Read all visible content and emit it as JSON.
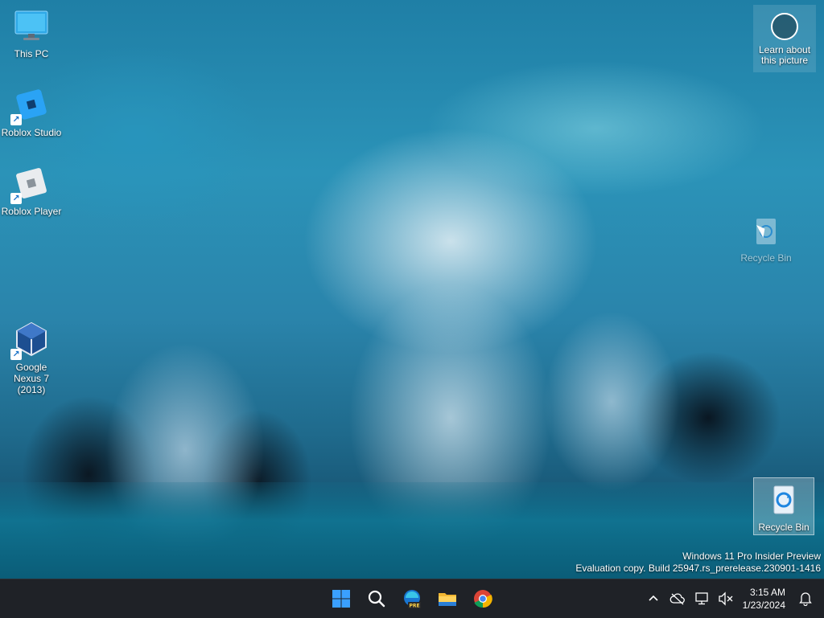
{
  "desktop": {
    "icons_left": [
      {
        "label": "This PC",
        "icon": "monitor-icon"
      },
      {
        "label": "Roblox Studio",
        "icon": "roblox-studio-icon"
      },
      {
        "label": "Roblox Player",
        "icon": "roblox-player-icon"
      },
      {
        "label": "Google Nexus 7 (2013)",
        "icon": "virtualbox-icon"
      }
    ],
    "learn": {
      "label": "Learn about this picture",
      "icon": "camera-icon"
    },
    "recycle_ghost": {
      "label": "Recycle Bin",
      "icon": "recycle-bin-icon"
    },
    "recycle": {
      "label": "Recycle Bin",
      "icon": "recycle-bin-icon"
    },
    "watermark": {
      "line1": "Windows 11 Pro Insider Preview",
      "line2": "Evaluation copy. Build 25947.rs_prerelease.230901-1416"
    }
  },
  "taskbar": {
    "apps": [
      {
        "name": "start",
        "icon": "windows-start-icon"
      },
      {
        "name": "search",
        "icon": "search-icon"
      },
      {
        "name": "edge-preview",
        "icon": "edge-preview-icon",
        "badge": "PRE"
      },
      {
        "name": "file-explorer",
        "icon": "folder-icon"
      },
      {
        "name": "chrome",
        "icon": "chrome-icon"
      }
    ],
    "tray": {
      "icons": [
        "chevron-up-icon",
        "cloud-offline-icon",
        "network-icon",
        "volume-muted-icon"
      ],
      "time": "3:15 AM",
      "date": "1/23/2024",
      "notification_icon": "bell-icon"
    }
  },
  "colors": {
    "taskbar_bg": "#1f2227",
    "accent_blue": "#1e90ff"
  }
}
